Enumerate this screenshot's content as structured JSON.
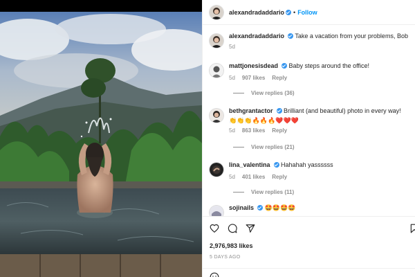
{
  "post": {
    "username": "alexandradaddario",
    "follow_label": "Follow",
    "separator": "•",
    "likes": "2,976,983 likes",
    "time_ago": "5 DAYS AGO"
  },
  "caption": {
    "username": "alexandradaddario",
    "text": "Take a vacation from your problems, Bob",
    "age": "5d"
  },
  "comments": [
    {
      "username": "mattjonesisdead",
      "text": "Baby steps around the office!",
      "age": "5d",
      "likes": "907 likes",
      "reply_label": "Reply",
      "view_replies": "View replies (36)"
    },
    {
      "username": "bethgrantactor",
      "text": "Brilliant (and beautiful) photo in every way!",
      "emojis": "👏👏👏🔥🔥🔥❤️❤️❤️",
      "age": "5d",
      "likes": "863 likes",
      "reply_label": "Reply",
      "view_replies": "View replies (21)"
    },
    {
      "username": "lina_valentina",
      "text": "Hahahah yassssss",
      "age": "5d",
      "likes": "401 likes",
      "reply_label": "Reply",
      "view_replies": "View replies (11)"
    },
    {
      "username": "sojinails",
      "text": "🤩🤩🤩🤩"
    }
  ],
  "icons": {
    "like": "heart-icon",
    "comment": "speech-bubble-icon",
    "share": "paper-plane-icon",
    "save": "bookmark-icon",
    "verified": "verified-badge-icon",
    "add_comment": "smiley-icon"
  },
  "colors": {
    "accent": "#0095f6",
    "verified": "#3897f0",
    "text": "#262626",
    "secondary": "#8e8e8e"
  }
}
